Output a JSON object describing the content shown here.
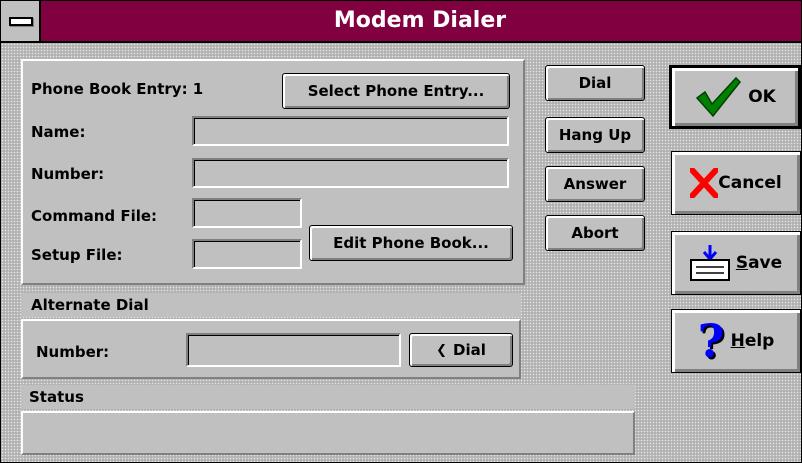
{
  "window": {
    "title": "Modem Dialer"
  },
  "entry": {
    "phone_book_label": "Phone Book Entry: 1",
    "select_button": "Select Phone Entry...",
    "name_label": "Name:",
    "name_value": "",
    "number_label": "Number:",
    "number_value": "",
    "command_file_label": "Command File:",
    "command_file_value": "",
    "setup_file_label": "Setup File:",
    "setup_file_value": "",
    "edit_button": "Edit Phone Book..."
  },
  "alternate": {
    "header": "Alternate Dial",
    "number_label": "Number:",
    "number_value": "",
    "dial_button": "Dial"
  },
  "status": {
    "header": "Status",
    "text": ""
  },
  "actions": {
    "dial": "Dial",
    "hang_up": "Hang Up",
    "answer": "Answer",
    "abort": "Abort"
  },
  "big_buttons": {
    "ok": "OK",
    "cancel": "Cancel",
    "save_first": "S",
    "save_rest": "ave",
    "help_first": "H",
    "help_rest": "elp"
  },
  "colors": {
    "titlebar": "#800040",
    "check": "#008000",
    "cancel_x": "#ff0000",
    "help_q": "#0000ff"
  }
}
